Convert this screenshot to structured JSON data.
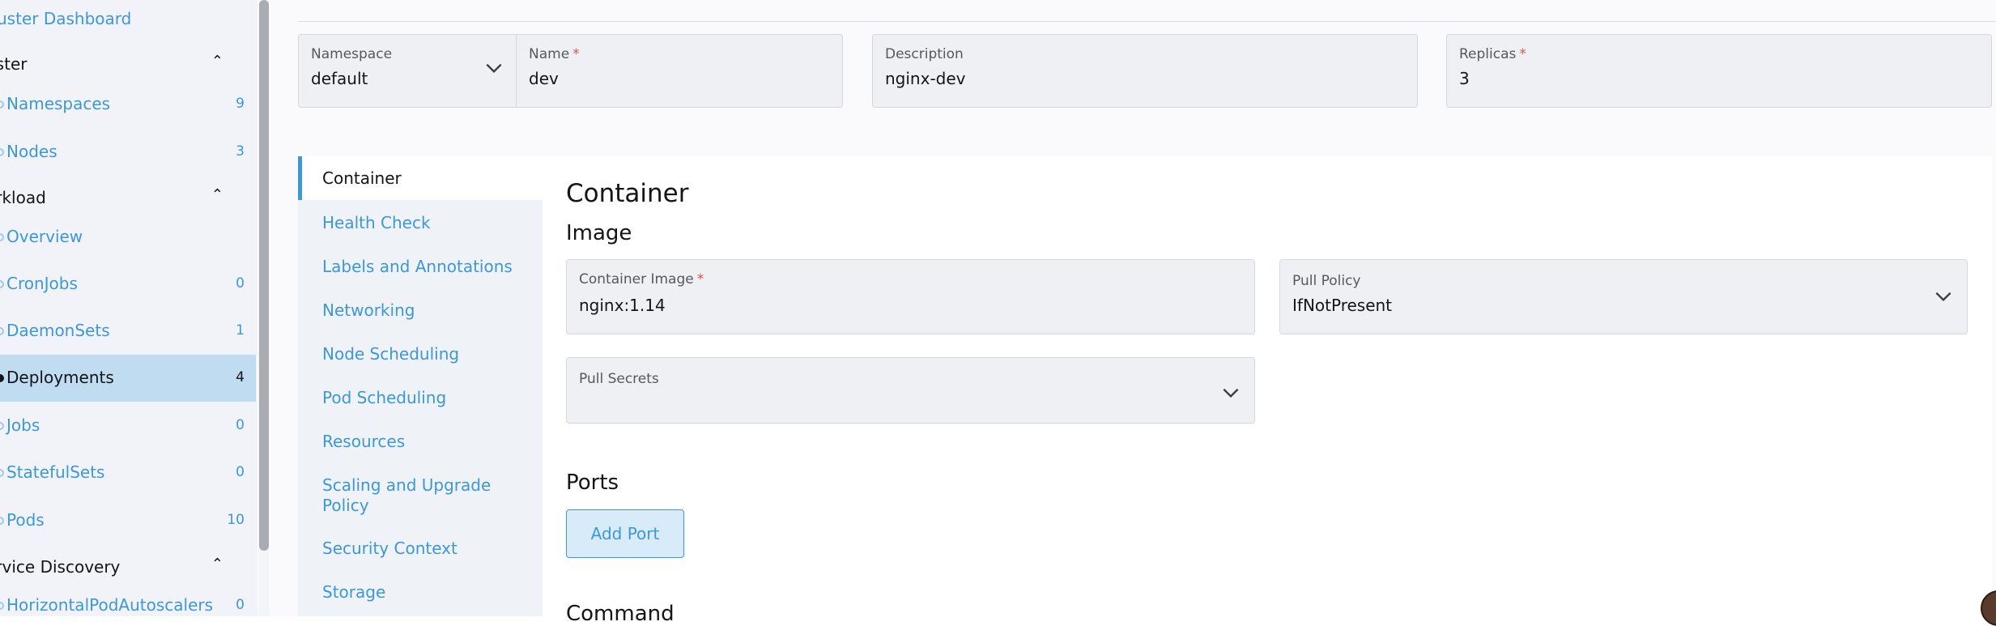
{
  "sidebar": {
    "cluster_dashboard": "uster Dashboard",
    "groups": {
      "cluster": "uster",
      "workload": "orkload",
      "service_discovery": "ervice Discovery"
    },
    "items": [
      {
        "label": "Namespaces",
        "count": "9"
      },
      {
        "label": "Nodes",
        "count": "3"
      },
      {
        "label": "Overview",
        "count": ""
      },
      {
        "label": "CronJobs",
        "count": "0"
      },
      {
        "label": "DaemonSets",
        "count": "1"
      },
      {
        "label": "Deployments",
        "count": "4"
      },
      {
        "label": "Jobs",
        "count": "0"
      },
      {
        "label": "StatefulSets",
        "count": "0"
      },
      {
        "label": "Pods",
        "count": "10"
      },
      {
        "label": "HorizontalPodAutoscalers",
        "count": "0"
      }
    ]
  },
  "form": {
    "namespace": {
      "label": "Namespace",
      "value": "default"
    },
    "name": {
      "label": "Name",
      "value": "dev"
    },
    "description": {
      "label": "Description",
      "value": "nginx-dev"
    },
    "replicas": {
      "label": "Replicas",
      "value": "3"
    }
  },
  "tabs": [
    "Container",
    "Health Check",
    "Labels and Annotations",
    "Networking",
    "Node Scheduling",
    "Pod Scheduling",
    "Resources",
    "Scaling and Upgrade Policy",
    "Security Context",
    "Storage"
  ],
  "container": {
    "title": "Container",
    "image_section": "Image",
    "container_image": {
      "label": "Container Image",
      "value": "nginx:1.14"
    },
    "pull_policy": {
      "label": "Pull Policy",
      "value": "IfNotPresent"
    },
    "pull_secrets": {
      "label": "Pull Secrets",
      "value": ""
    },
    "ports_section": "Ports",
    "add_port": "Add Port",
    "command_section": "Command"
  },
  "colors": {
    "accent": "#3d98d3",
    "active_item_bg": "#bfdcf1",
    "required_star": "#e05252"
  }
}
